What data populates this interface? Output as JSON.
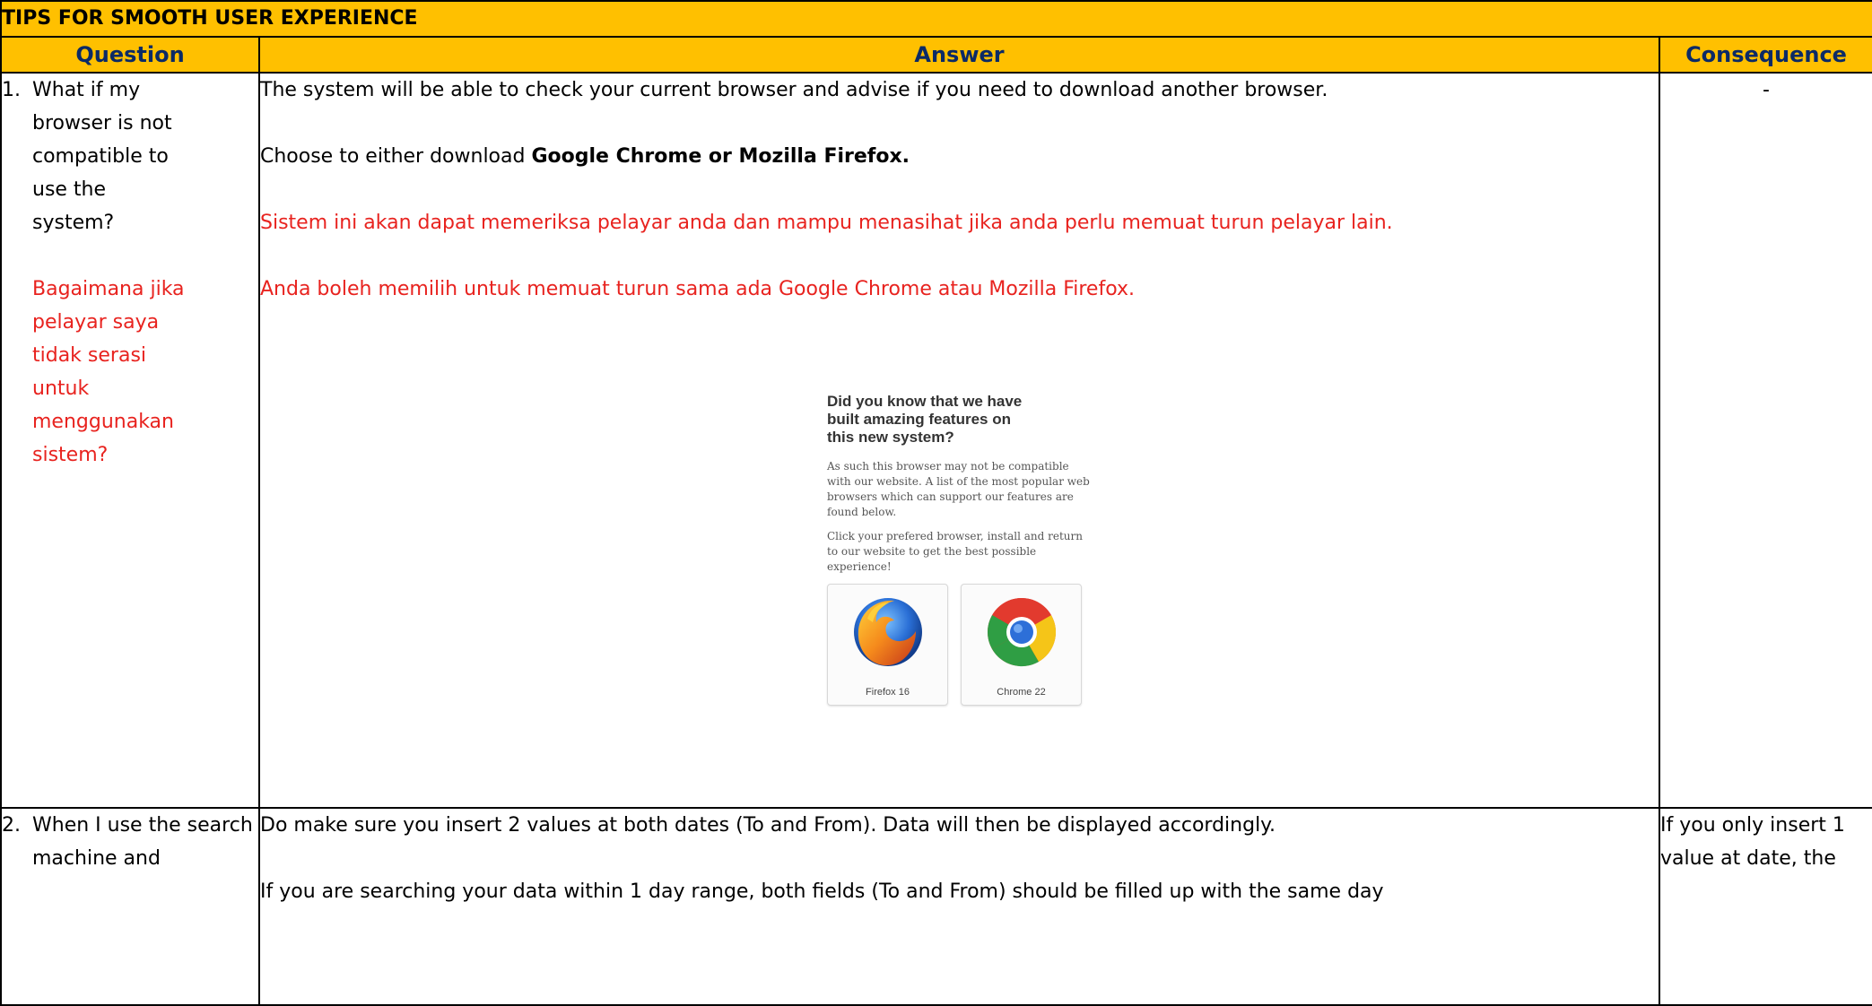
{
  "title": "TIPS FOR SMOOTH USER EXPERIENCE",
  "headers": {
    "question": "Question",
    "answer": "Answer",
    "consequence": "Consequence"
  },
  "rows": [
    {
      "num": "1.",
      "question_en": "What if my browser is not compatible to use the system?",
      "question_ms": "Bagaimana jika pelayar saya tidak serasi untuk menggunakan sistem?",
      "answer_1": "The system will be able to check your current browser and advise if you need to download another browser.",
      "answer_2_prefix": "Choose to either download ",
      "answer_2_bold": "Google Chrome or Mozilla Firefox.",
      "answer_ms_1": "Sistem ini akan dapat memeriksa pelayar anda dan mampu menasihat jika anda perlu memuat turun pelayar lain.",
      "answer_ms_2": "Anda boleh memilih untuk memuat turun sama ada Google Chrome atau Mozilla Firefox.",
      "consequence": "-"
    },
    {
      "num": "2.",
      "question_en": "When I use the search machine and",
      "answer_1": "Do make sure you insert 2 values at both dates (To and From). Data will then be displayed accordingly.",
      "answer_2": "If you are searching your data within 1 day range, both fields (To and From) should be filled up with the same day",
      "consequence": "If you only insert 1 value at date, the"
    }
  ],
  "notice": {
    "heading": "Did you know that we have built amazing features on this new system?",
    "para1": "As such this browser may not be compatible with our website. A list of the most popular web browsers which can support our features are found below.",
    "para2": "Click your prefered browser, install and return to our website to get the best possible experience!",
    "browsers": [
      {
        "label": "Firefox 16",
        "icon": "firefox-icon"
      },
      {
        "label": "Chrome 22",
        "icon": "chrome-icon"
      }
    ]
  }
}
